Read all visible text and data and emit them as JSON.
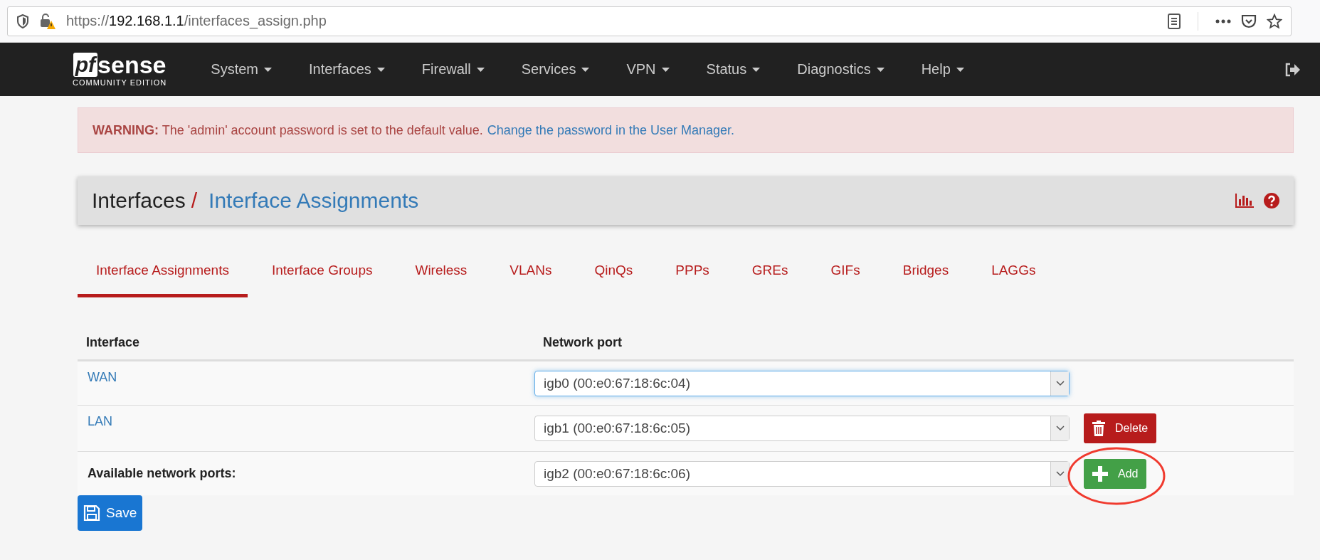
{
  "browser": {
    "url_scheme": "https://",
    "url_host": "192.168.1.1",
    "url_path": "/interfaces_assign.php"
  },
  "logo": {
    "mark": "pf",
    "name": "sense",
    "edition": "COMMUNITY EDITION"
  },
  "nav": [
    {
      "label": "System"
    },
    {
      "label": "Interfaces"
    },
    {
      "label": "Firewall"
    },
    {
      "label": "Services"
    },
    {
      "label": "VPN"
    },
    {
      "label": "Status"
    },
    {
      "label": "Diagnostics"
    },
    {
      "label": "Help"
    }
  ],
  "warning": {
    "label": "WARNING:",
    "message": "The 'admin' account password is set to the default value.",
    "link": "Change the password in the User Manager."
  },
  "breadcrumb": {
    "parent": "Interfaces",
    "separator": "/",
    "current": "Interface Assignments"
  },
  "tabs": [
    {
      "label": "Interface Assignments",
      "selected": true
    },
    {
      "label": "Interface Groups",
      "selected": false
    },
    {
      "label": "Wireless",
      "selected": false
    },
    {
      "label": "VLANs",
      "selected": false
    },
    {
      "label": "QinQs",
      "selected": false
    },
    {
      "label": "PPPs",
      "selected": false
    },
    {
      "label": "GREs",
      "selected": false
    },
    {
      "label": "GIFs",
      "selected": false
    },
    {
      "label": "Bridges",
      "selected": false
    },
    {
      "label": "LAGGs",
      "selected": false
    }
  ],
  "table": {
    "columns": [
      "Interface",
      "Network port"
    ],
    "rows": [
      {
        "kind": "interface",
        "name": "WAN",
        "port": "igb0 (00:e0:67:18:6c:04)",
        "focused": true
      },
      {
        "kind": "interface",
        "name": "LAN",
        "port": "igb1 (00:e0:67:18:6c:05)",
        "focused": false,
        "action": {
          "kind": "delete",
          "label": "Delete"
        }
      },
      {
        "kind": "available",
        "name": "Available network ports:",
        "port": "igb2 (00:e0:67:18:6c:06)",
        "focused": false,
        "action": {
          "kind": "add",
          "label": "Add"
        }
      }
    ]
  },
  "save": {
    "label": "Save"
  }
}
